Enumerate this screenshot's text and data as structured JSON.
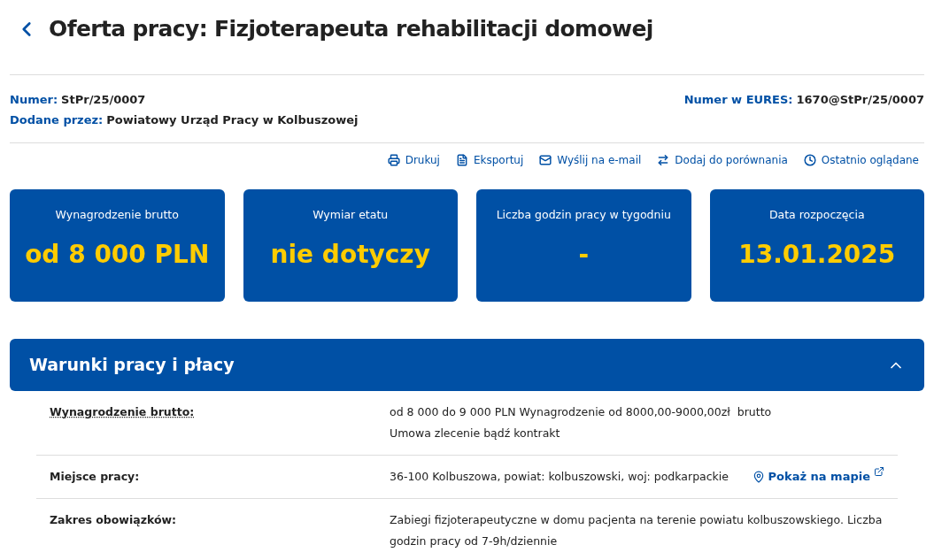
{
  "title": "Oferta pracy: Fizjoterapeuta rehabilitacji domowej",
  "meta": {
    "number_label": "Numer:",
    "number": "StPr/25/0007",
    "added_label": "Dodane przez:",
    "added": "Powiatowy Urząd Pracy w Kolbuszowej",
    "eures_label": "Numer w EURES:",
    "eures": "1670@StPr/25/0007"
  },
  "actions": [
    {
      "kind": "print",
      "label": "Drukuj"
    },
    {
      "kind": "export",
      "label": "Eksportuj"
    },
    {
      "kind": "email",
      "label": "Wyślij na e-mail"
    },
    {
      "kind": "compare",
      "label": "Dodaj do porównania"
    },
    {
      "kind": "recent",
      "label": "Ostatnio oglądane"
    }
  ],
  "cards": [
    {
      "label": "Wynagrodzenie brutto",
      "value": "od 8 000 PLN"
    },
    {
      "label": "Wymiar etatu",
      "value": "nie dotyczy"
    },
    {
      "label": "Liczba godzin pracy w tygodniu",
      "value": "-"
    },
    {
      "label": "Data rozpoczęcia",
      "value": "13.01.2025"
    }
  ],
  "section": {
    "title": "Warunki pracy i płacy",
    "expanded": true,
    "rows": [
      {
        "label": "Wynagrodzenie brutto:",
        "dotted": true,
        "lines": [
          "od 8 000 do 9 000 PLN Wynagrodzenie od 8000,00-9000,00zł  brutto",
          "Umowa zlecenie bądź kontrakt"
        ]
      },
      {
        "label": "Miejsce pracy:",
        "dotted": false,
        "lines": [
          "36-100 Kolbuszowa, powiat: kolbuszowski, woj: podkarpackie"
        ],
        "link": "Pokaż na mapie"
      },
      {
        "label": "Zakres obowiązków:",
        "dotted": false,
        "lines": [
          "Zabiegi fizjoterapeutyczne w domu pacjenta na terenie powiatu kolbuszowskiego. Liczba godzin pracy od 7-9h/dziennie"
        ]
      }
    ]
  }
}
